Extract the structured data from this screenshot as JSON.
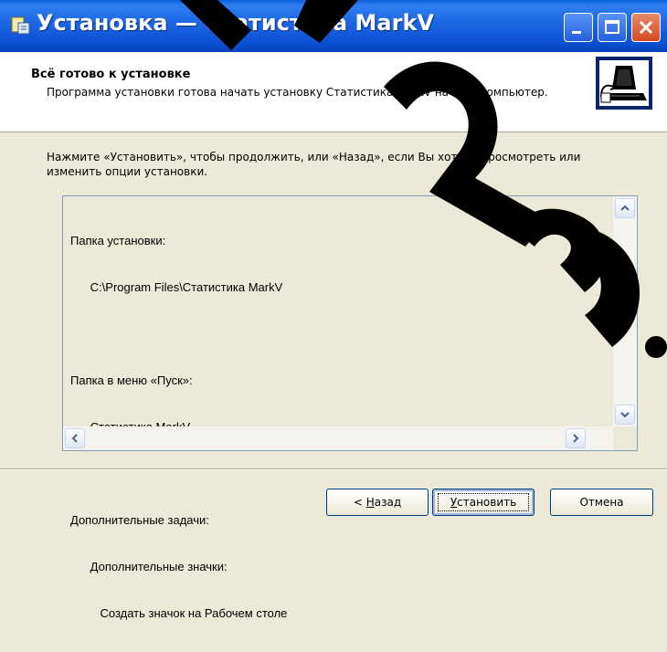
{
  "window": {
    "title": "Установка — Статистика MarkV"
  },
  "header": {
    "title": "Всё готово к установке",
    "subtitle": "Программа установки готова начать установку Статистика MarkV на Ваш компьютер."
  },
  "body": {
    "intro": "Нажмите «Установить», чтобы продолжить, или «Назад», если Вы хотите просмотреть или изменить опции установки.",
    "memo_lines": [
      "Папка установки:",
      "      C:\\Program Files\\Статистика MarkV",
      "",
      "Папка в меню «Пуск»:",
      "      Статистика MarkV",
      "",
      "Дополнительные задачи:",
      "      Дополнительные значки:",
      "         Создать значок на Рабочем столе"
    ]
  },
  "buttons": {
    "back_prefix": "< ",
    "back_accel": "Н",
    "back_rest": "азад",
    "install_accel": "У",
    "install_rest": "становить",
    "cancel": "Отмена"
  },
  "icons": {
    "app": "installer-icon",
    "header": "computer-install-icon",
    "minimize": "minimize-icon",
    "maximize": "maximize-icon",
    "close": "close-icon"
  },
  "colors": {
    "titlebar": "#0a4fd0",
    "close_button": "#d64a22",
    "dialog_bg": "#ece9d8"
  }
}
